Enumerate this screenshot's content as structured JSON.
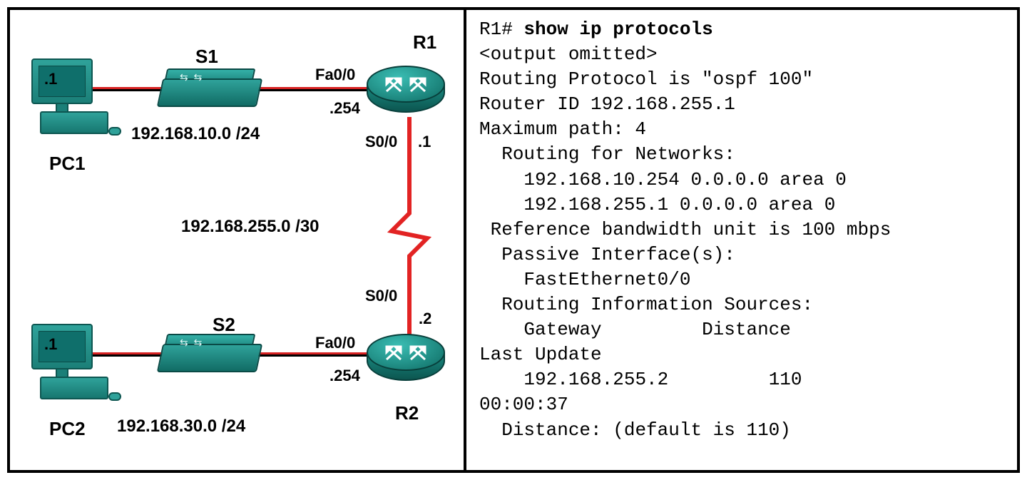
{
  "diagram": {
    "devices": {
      "pc1": {
        "name": "PC1",
        "host": ".1"
      },
      "pc2": {
        "name": "PC2",
        "host": ".1"
      },
      "s1": {
        "name": "S1"
      },
      "s2": {
        "name": "S2"
      },
      "r1": {
        "name": "R1"
      },
      "r2": {
        "name": "R2"
      }
    },
    "interfaces": {
      "r1_fa00": "Fa0/0",
      "r1_fa00_ip": ".254",
      "r1_s00": "S0/0",
      "r1_s00_ip": ".1",
      "r2_fa00": "Fa0/0",
      "r2_fa00_ip": ".254",
      "r2_s00": "S0/0",
      "r2_s00_ip": ".2"
    },
    "networks": {
      "lan1": "192.168.10.0 /24",
      "lan2": "192.168.30.0 /24",
      "wan": "192.168.255.0 /30"
    }
  },
  "cli": {
    "prompt": "R1#",
    "command": "show ip protocols",
    "omitted": "<output omitted>",
    "proto_line": "Routing Protocol is \"ospf 100\"",
    "router_id": "Router ID 192.168.255.1",
    "max_path": "Maximum path: 4",
    "routing_for": "Routing for Networks:",
    "net1": "192.168.10.254 0.0.0.0 area 0",
    "net2": "192.168.255.1 0.0.0.0 area 0",
    "ref_bw": "Reference bandwidth unit is 100 mbps",
    "passive_hdr": "Passive Interface(s):",
    "passive_if": "FastEthernet0/0",
    "ris_hdr": "Routing Information Sources:",
    "ris_cols": "Gateway         Distance",
    "last_update": "Last Update",
    "gw": "192.168.255.2",
    "dist": "110",
    "time": "00:00:37",
    "default_dist": "Distance: (default is 110)"
  }
}
